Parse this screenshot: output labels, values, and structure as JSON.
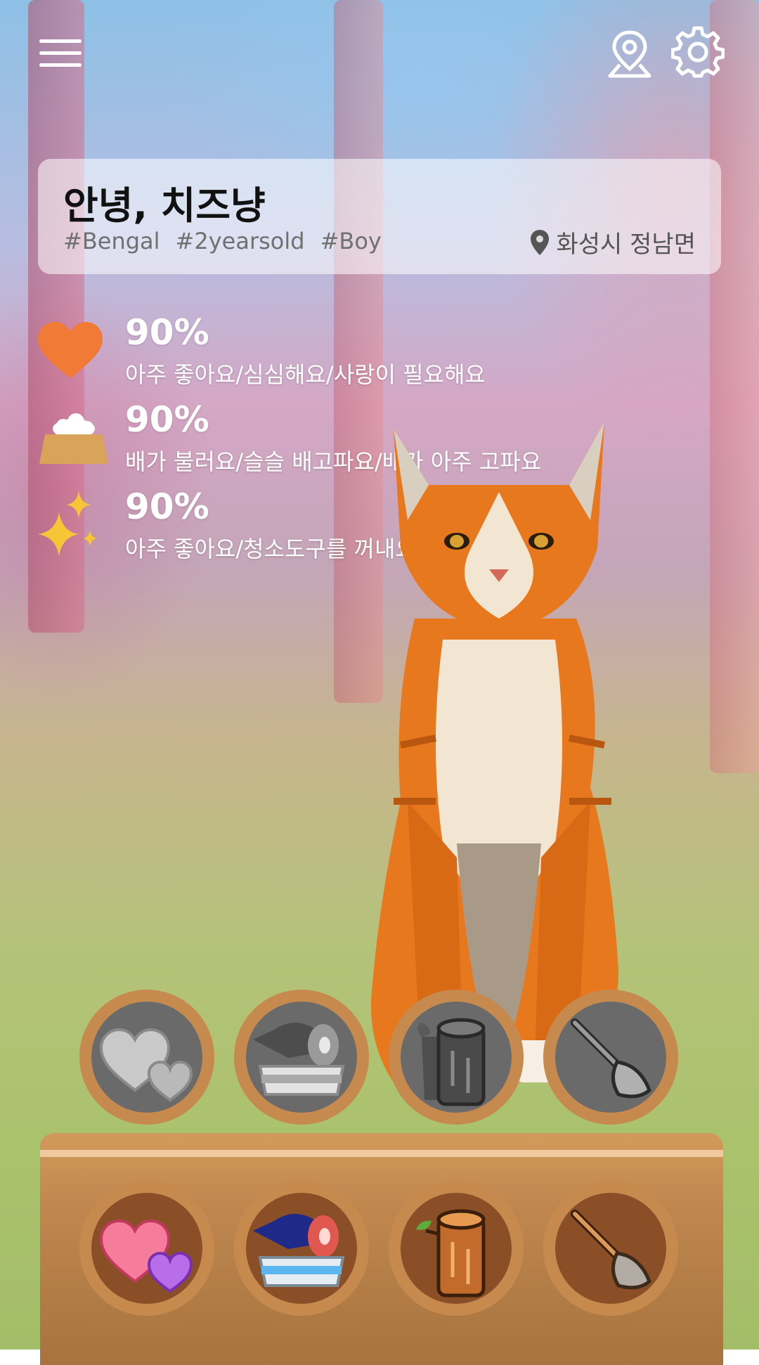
{
  "header": {
    "menu_icon": "hamburger-menu-icon",
    "location_icon": "map-pin-icon",
    "settings_icon": "gear-icon"
  },
  "profile": {
    "greeting": "안녕, 치즈냥",
    "tags": [
      "#Bengal",
      "#2yearsold",
      "#Boy"
    ],
    "location": "화성시 정남면"
  },
  "stats": [
    {
      "icon": "heart-icon",
      "value": "90%",
      "description": "아주 좋아요/심심해요/사랑이 필요해요",
      "color": "#f07a36"
    },
    {
      "icon": "food-bowl-icon",
      "value": "90%",
      "description": "배가 불러요/슬슬 배고파요/배가 아주 고파요",
      "color": "#d9a35a"
    },
    {
      "icon": "sparkle-icon",
      "value": "90%",
      "description": "아주 좋아요/청소도구를 꺼내요/너무 더러워요",
      "color": "#f6c637"
    }
  ],
  "actions_inactive": [
    {
      "name": "affection",
      "icon": "hearts-icon"
    },
    {
      "name": "feed",
      "icon": "fish-bowl-icon"
    },
    {
      "name": "scratch",
      "icon": "log-icon"
    },
    {
      "name": "clean",
      "icon": "broom-icon"
    }
  ],
  "actions_active": [
    {
      "name": "affection",
      "icon": "hearts-icon"
    },
    {
      "name": "feed",
      "icon": "fish-bowl-icon"
    },
    {
      "name": "scratch",
      "icon": "log-icon"
    },
    {
      "name": "clean",
      "icon": "broom-icon"
    }
  ],
  "colors": {
    "button_ring": "#c78a4e",
    "inactive_fill": "#6a6a6a",
    "active_fill": "#8a4f27",
    "tray": "#c0884f"
  }
}
